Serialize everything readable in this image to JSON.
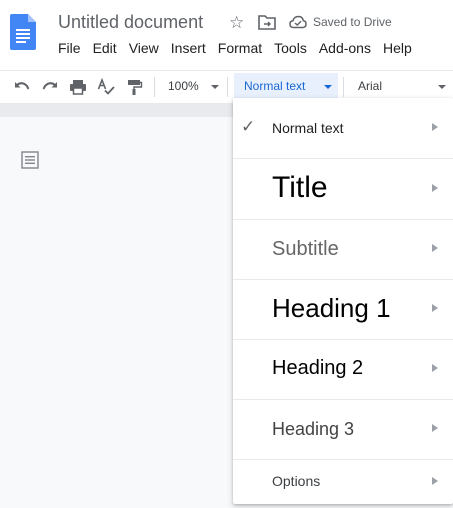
{
  "header": {
    "doc_title": "Untitled document",
    "saved_status": "Saved to Drive",
    "menu": [
      "File",
      "Edit",
      "View",
      "Insert",
      "Format",
      "Tools",
      "Add-ons",
      "Help"
    ]
  },
  "toolbar": {
    "zoom": "100%",
    "paragraph_style": "Normal text",
    "font": "Arial"
  },
  "style_menu": {
    "items": [
      {
        "label": "Normal text",
        "checked": true
      },
      {
        "label": "Title"
      },
      {
        "label": "Subtitle"
      },
      {
        "label": "Heading 1"
      },
      {
        "label": "Heading 2"
      },
      {
        "label": "Heading 3"
      },
      {
        "label": "Options"
      }
    ]
  },
  "colors": {
    "docs_blue": "#4285f4",
    "active_select_bg": "#e8f0fe",
    "active_select_text": "#1967d2"
  }
}
